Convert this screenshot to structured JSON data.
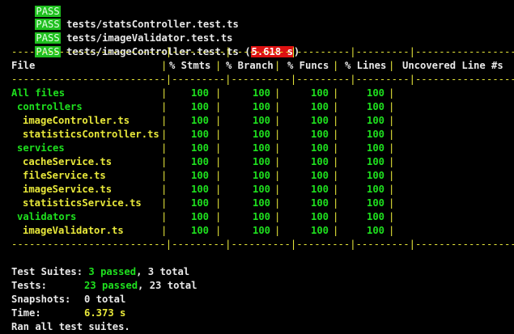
{
  "top_partial": "tests/... (partially hidden)",
  "test_files": [
    {
      "badge": "PASS",
      "path": "tests/statsController.test.ts",
      "time": ""
    },
    {
      "badge": "PASS",
      "path": "tests/imageValidator.test.ts",
      "time": ""
    },
    {
      "badge": "PASS",
      "path": "tests/imageController.test.ts",
      "time": "5.618 s"
    }
  ],
  "coverage": {
    "dash_line": "--------------------------|---------|----------|---------|---------|-------------------",
    "headers": [
      "File",
      "% Stmts",
      "% Branch",
      "% Funcs",
      "% Lines",
      "Uncovered Line #s"
    ],
    "rows": [
      {
        "label": "All files",
        "indent": 0,
        "stmts": "100",
        "branch": "100",
        "funcs": "100",
        "lines": "100",
        "uncovered": ""
      },
      {
        "label": "controllers",
        "indent": 1,
        "stmts": "100",
        "branch": "100",
        "funcs": "100",
        "lines": "100",
        "uncovered": ""
      },
      {
        "label": "imageController.ts",
        "indent": 2,
        "stmts": "100",
        "branch": "100",
        "funcs": "100",
        "lines": "100",
        "uncovered": ""
      },
      {
        "label": "statisticsController.ts",
        "indent": 2,
        "stmts": "100",
        "branch": "100",
        "funcs": "100",
        "lines": "100",
        "uncovered": ""
      },
      {
        "label": "services",
        "indent": 1,
        "stmts": "100",
        "branch": "100",
        "funcs": "100",
        "lines": "100",
        "uncovered": ""
      },
      {
        "label": "cacheService.ts",
        "indent": 2,
        "stmts": "100",
        "branch": "100",
        "funcs": "100",
        "lines": "100",
        "uncovered": ""
      },
      {
        "label": "fileService.ts",
        "indent": 2,
        "stmts": "100",
        "branch": "100",
        "funcs": "100",
        "lines": "100",
        "uncovered": ""
      },
      {
        "label": "imageService.ts",
        "indent": 2,
        "stmts": "100",
        "branch": "100",
        "funcs": "100",
        "lines": "100",
        "uncovered": ""
      },
      {
        "label": "statisticsService.ts",
        "indent": 2,
        "stmts": "100",
        "branch": "100",
        "funcs": "100",
        "lines": "100",
        "uncovered": ""
      },
      {
        "label": "validators",
        "indent": 1,
        "stmts": "100",
        "branch": "100",
        "funcs": "100",
        "lines": "100",
        "uncovered": ""
      },
      {
        "label": "imageValidator.ts",
        "indent": 2,
        "stmts": "100",
        "branch": "100",
        "funcs": "100",
        "lines": "100",
        "uncovered": ""
      }
    ]
  },
  "summary": {
    "suites_label": "Test Suites:",
    "suites_passed": "3 passed",
    "suites_total": ", 3 total",
    "tests_label": "Tests:",
    "tests_passed": "23 passed",
    "tests_total": ", 23 total",
    "snapshots_label": "Snapshots:",
    "snapshots_value": "0 total",
    "time_label": "Time:",
    "time_value": "6.373 s",
    "ran_text": "Ran all test suites."
  },
  "colors": {
    "background": "#000000",
    "pass_badge": "#1fc01f",
    "green": "#1ee01e",
    "yellow": "#e8e83a",
    "slow_time_bg": "#dd1111"
  }
}
